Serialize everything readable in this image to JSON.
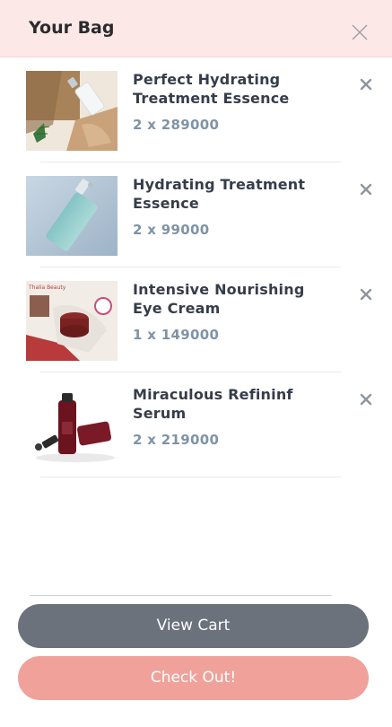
{
  "header": {
    "title": "Your Bag",
    "close_icon": "close-icon"
  },
  "items": [
    {
      "name": "Perfect Hydrating Treatment Essence",
      "qty": "2 x 289000",
      "image": "essence-bottle-on-burlap"
    },
    {
      "name": "Hydrating Treatment Essence",
      "qty": "2 x 99000",
      "image": "teal-bottle"
    },
    {
      "name": "Intensive Nourishing Eye Cream",
      "qty": "1 x 149000",
      "image": "eye-cream-jar",
      "image_text": "Thalia Beauty"
    },
    {
      "name": "Miraculous Refininf Serum",
      "qty": "2 x 219000",
      "image": "red-serum-bottles"
    }
  ],
  "buttons": {
    "view_cart": "View Cart",
    "checkout": "Check Out!"
  },
  "colors": {
    "header_bg": "#fde8e8",
    "view_cart": "#6b727b",
    "checkout": "#f0a19a",
    "qty_text": "#7f93a6"
  }
}
